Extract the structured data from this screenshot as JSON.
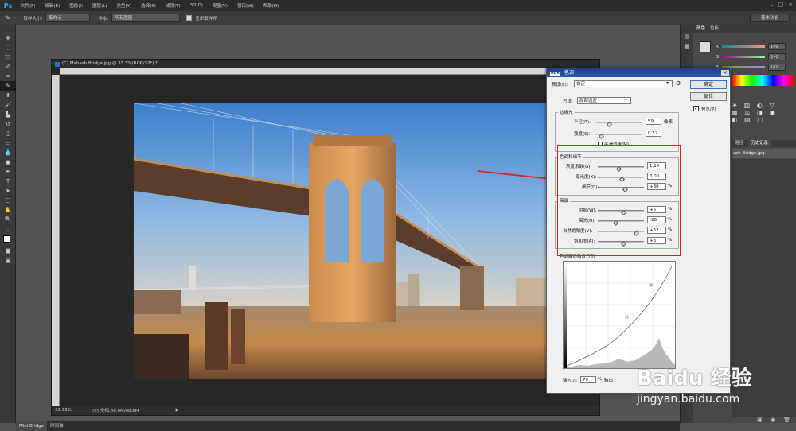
{
  "app": {
    "logo": "Ps"
  },
  "menubar": {
    "items": [
      "文件(F)",
      "编辑(E)",
      "图像(I)",
      "图层(L)",
      "类型(Y)",
      "选择(S)",
      "滤镜(T)",
      "3D(D)",
      "视图(V)",
      "窗口(W)",
      "帮助(H)"
    ]
  },
  "options": {
    "sample_size_label": "取样大小:",
    "sample_size_value": "取样点",
    "sample_label": "样本:",
    "sample_value": "所有图层",
    "show_ring_label": "显示取样环",
    "workspace": "基本功能"
  },
  "document": {
    "tab_title": "(C) Mabash Bridge.jpg @ 33.3%(RGB/32*) *",
    "zoom": "33.33%",
    "status": "(C) 文档:68.6M/68.6M"
  },
  "bottombar": {
    "tabs": [
      "Mini Bridge",
      "时间轴"
    ]
  },
  "color_panel": {
    "tabs": [
      "颜色",
      "色板"
    ],
    "r_label": "R",
    "g_label": "G",
    "b_label": "B",
    "r": "149",
    "g": "142",
    "b": "142"
  },
  "right_panels": {
    "tabs2": [
      "路径",
      "历史记录"
    ],
    "history_item": "ash Bridge.jpg"
  },
  "dialog": {
    "title": "色调",
    "title_badge": "HDR",
    "preset_label": "预设(E):",
    "preset_value": "自定",
    "ok": "确定",
    "reset": "复位",
    "preview": "预览(P)",
    "method_label": "方法:",
    "method_value": "局部适应",
    "edge_glow": {
      "title": "边缘光",
      "radius_label": "半径(R):",
      "radius": "59",
      "radius_unit": "像素",
      "strength_label": "强度(S):",
      "strength": "0.52",
      "smooth_label": "平滑边缘(M)"
    },
    "tone_detail": {
      "title": "色调和细节",
      "gamma_label": "灰度系数(G):",
      "gamma": "1.15",
      "exposure_label": "曝光度(X):",
      "exposure": "0.00",
      "detail_label": "细节(D):",
      "detail": "+30",
      "unit": "%"
    },
    "advanced": {
      "title": "高级",
      "shadow_label": "阴影(W):",
      "shadow": "+5",
      "highlight_label": "高光(H):",
      "highlight": "-26",
      "vibrance_label": "自然饱和度(V):",
      "vibrance": "+62",
      "saturation_label": "饱和度(A):",
      "saturation": "+3",
      "unit": "%"
    },
    "curve": {
      "title": "色调曲线和直方图",
      "input_label": "输入(I):",
      "input": "79",
      "input_unit": "%",
      "output_label": "输出"
    }
  },
  "watermark": {
    "cn": "Baidu 经验",
    "url": "jingyan.baidu.com"
  }
}
